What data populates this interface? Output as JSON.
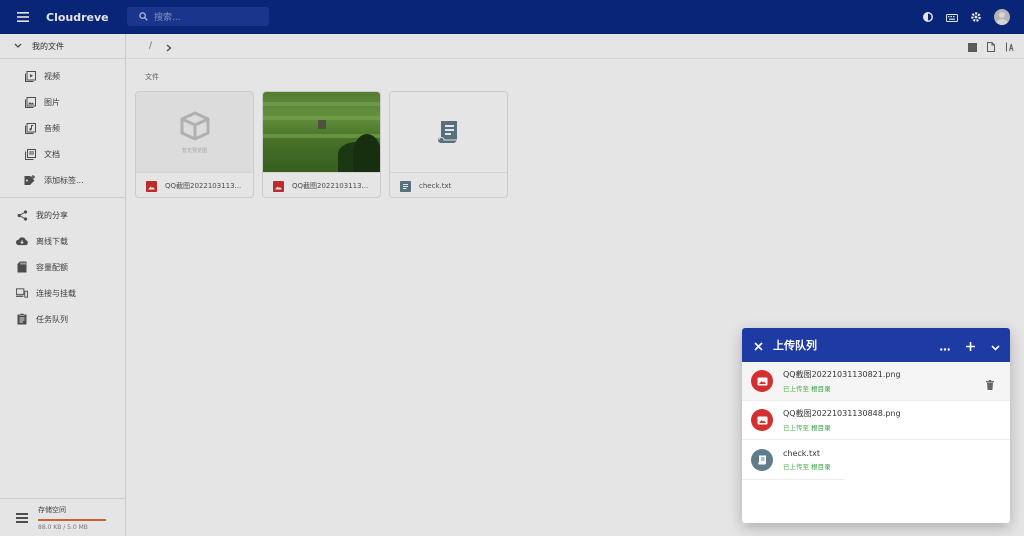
{
  "app": {
    "title": "Cloudreve"
  },
  "search": {
    "placeholder": "搜索..."
  },
  "sidebar": {
    "header": "我的文件",
    "sub_items": [
      {
        "label": "视频",
        "icon": "video-icon"
      },
      {
        "label": "图片",
        "icon": "image-icon"
      },
      {
        "label": "音频",
        "icon": "audio-icon"
      },
      {
        "label": "文档",
        "icon": "document-icon"
      },
      {
        "label": "添加标签...",
        "icon": "tag-add-icon"
      }
    ],
    "items": [
      {
        "label": "我的分享",
        "icon": "share-icon"
      },
      {
        "label": "离线下载",
        "icon": "cloud-download-icon"
      },
      {
        "label": "容量配额",
        "icon": "sd-card-icon"
      },
      {
        "label": "连接与挂载",
        "icon": "devices-icon"
      },
      {
        "label": "任务队列",
        "icon": "clipboard-icon"
      }
    ],
    "storage": {
      "label": "存储空间",
      "size": "88.0 KB / 5.0 MB",
      "fill_fraction": 1.0
    }
  },
  "breadcrumb": {
    "root": "/"
  },
  "section_label": "文件",
  "files": [
    {
      "name": "QQ截图2022103113...",
      "type": "image",
      "preview": "none",
      "no_preview_text": "暂无预览图"
    },
    {
      "name": "QQ截图2022103113...",
      "type": "image",
      "preview": "photo"
    },
    {
      "name": "check.txt",
      "type": "text",
      "preview": "text-icon"
    }
  ],
  "upload_dialog": {
    "title": "上传队列",
    "items": [
      {
        "name": "QQ截图20221031130821.png",
        "status": "已上传至",
        "dir": "根目录",
        "icon_color": "#d32f2f",
        "kind": "image"
      },
      {
        "name": "QQ截图20221031130848.png",
        "status": "已上传至",
        "dir": "根目录",
        "icon_color": "#d32f2f",
        "kind": "image"
      },
      {
        "name": "check.txt",
        "status": "已上传至",
        "dir": "根目录",
        "icon_color": "#607d8b",
        "kind": "text"
      }
    ]
  },
  "colors": {
    "appbar": "#0b2a86",
    "dialog_header": "#1e3aa3",
    "success": "#4caf50",
    "image_red": "#d32f2f"
  }
}
